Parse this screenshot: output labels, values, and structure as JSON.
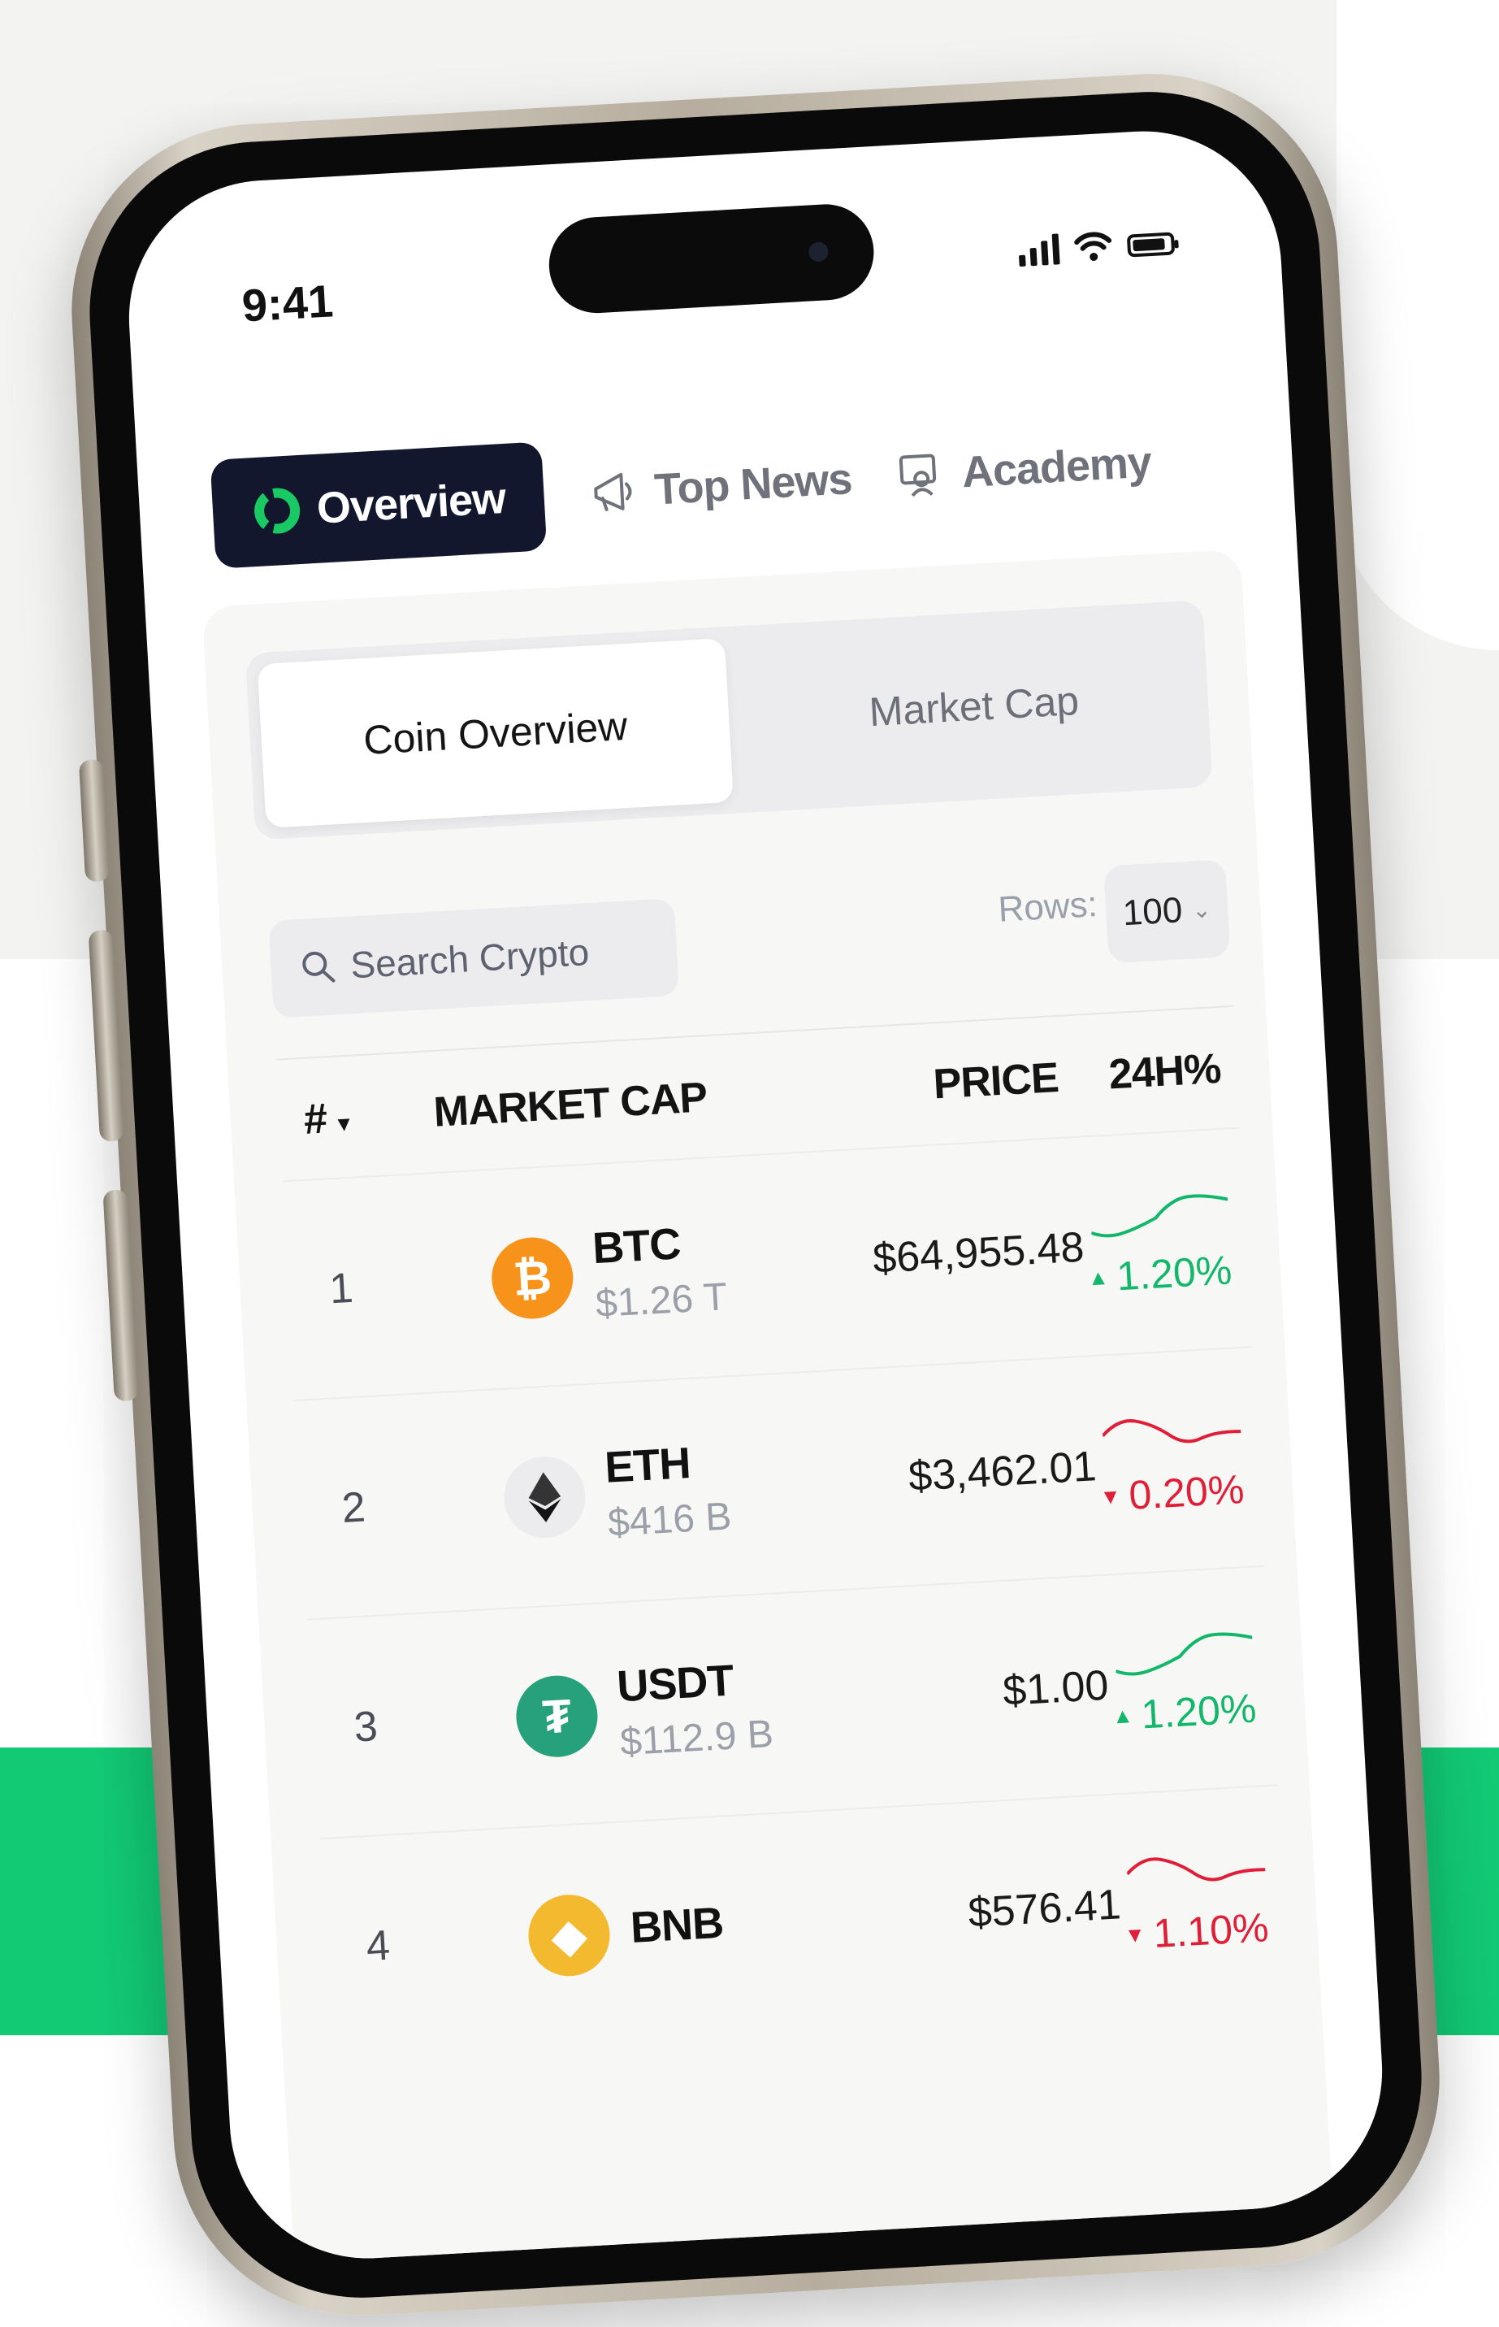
{
  "status_bar": {
    "time": "9:41"
  },
  "nav_tabs": [
    {
      "label": "Overview",
      "icon": "pie-chart-icon",
      "active": true
    },
    {
      "label": "Top News",
      "icon": "megaphone-icon",
      "active": false
    },
    {
      "label": "Academy",
      "icon": "academy-icon",
      "active": false
    }
  ],
  "segments": [
    {
      "label": "Coin Overview",
      "active": true
    },
    {
      "label": "Market Cap",
      "active": false
    }
  ],
  "search": {
    "placeholder": "Search Crypto"
  },
  "rows_selector": {
    "label": "Rows:",
    "value": "100"
  },
  "table": {
    "headers": {
      "rank": "#",
      "market_cap": "MARKET CAP",
      "price": "PRICE",
      "change": "24H%"
    },
    "rows": [
      {
        "rank": "1",
        "symbol": "BTC",
        "market_cap": "$1.26 T",
        "price": "$64,955.48",
        "change": "1.20%",
        "direction": "up",
        "icon": "bitcoin-icon",
        "color": "#f7931a"
      },
      {
        "rank": "2",
        "symbol": "ETH",
        "market_cap": "$416 B",
        "price": "$3,462.01",
        "change": "0.20%",
        "direction": "down",
        "icon": "ethereum-icon",
        "color": "#ececef"
      },
      {
        "rank": "3",
        "symbol": "USDT",
        "market_cap": "$112.9 B",
        "price": "$1.00",
        "change": "1.20%",
        "direction": "up",
        "icon": "tether-icon",
        "color": "#26a17b"
      },
      {
        "rank": "4",
        "symbol": "BNB",
        "market_cap": "",
        "price": "$576.41",
        "change": "1.10%",
        "direction": "down",
        "icon": "bnb-icon",
        "color": "#f3ba2f"
      }
    ]
  },
  "colors": {
    "accent_dark": "#13172e",
    "positive": "#12b76a",
    "negative": "#e01e37",
    "brand_green": "#12c974"
  }
}
